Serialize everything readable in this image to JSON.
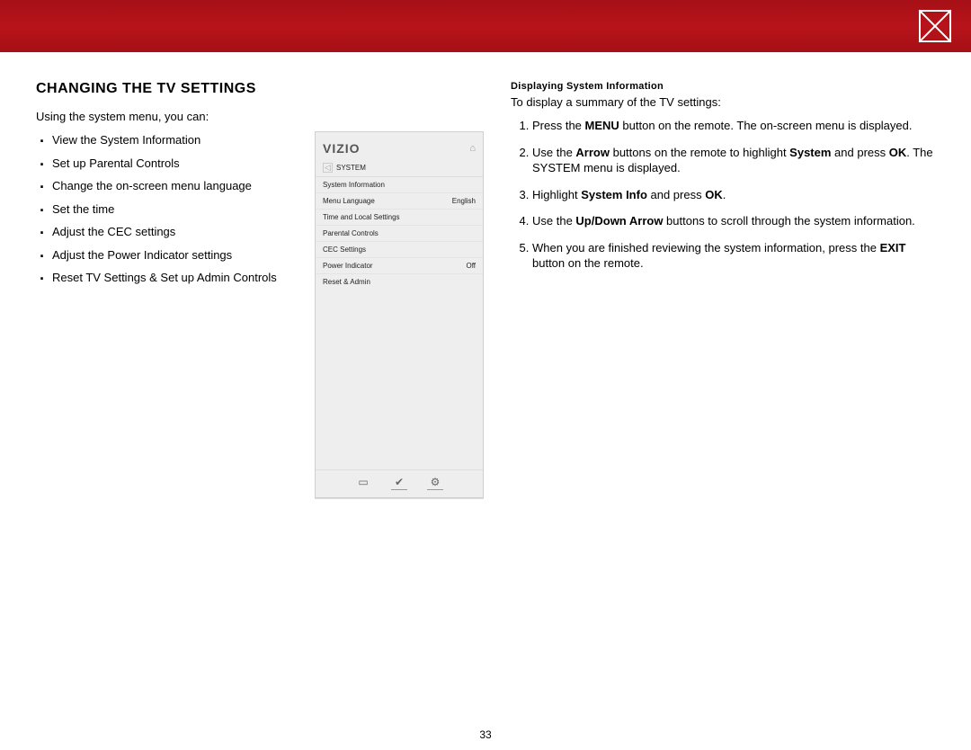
{
  "chapter_marker": "",
  "title": "CHANGING THE TV SETTINGS",
  "intro": "Using the system menu, you can:",
  "bullets": [
    "View the System Information",
    "Set up Parental Controls",
    "Change the on-screen menu language",
    "Set the time",
    "Adjust the CEC settings",
    "Adjust the Power Indicator settings",
    "Reset TV Settings & Set up Admin Controls"
  ],
  "osd": {
    "logo": "VIZIO",
    "breadcrumb": "SYSTEM",
    "items": [
      {
        "label": "System Information",
        "value": ""
      },
      {
        "label": "Menu Language",
        "value": "English"
      },
      {
        "label": "Time and Local Settings",
        "value": ""
      },
      {
        "label": "Parental Controls",
        "value": ""
      },
      {
        "label": "CEC Settings",
        "value": ""
      },
      {
        "label": "Power Indicator",
        "value": "Off"
      },
      {
        "label": "Reset & Admin",
        "value": ""
      }
    ],
    "footer_icons": {
      "wide": "▭",
      "v": "✔",
      "gear": "⚙"
    }
  },
  "right": {
    "heading_pre": "Displaying",
    "heading_post": "System Information",
    "intro": "To display a summary of the TV settings:",
    "steps": [
      {
        "parts": [
          "Press the ",
          {
            "bold": "MENU"
          },
          " button on the remote. The on-screen menu is displayed."
        ]
      },
      {
        "parts": [
          "Use the ",
          {
            "bold": "Arrow"
          },
          " buttons on the remote to highlight ",
          {
            "bold": "System"
          },
          " and press ",
          {
            "bold": "OK"
          },
          ". The SYSTEM menu is displayed."
        ]
      },
      {
        "parts": [
          "Highlight ",
          {
            "bold": "System Info"
          },
          " and press ",
          {
            "bold": "OK"
          },
          "."
        ]
      },
      {
        "parts": [
          "Use the ",
          {
            "bold": "Up/Down Arrow"
          },
          " buttons to scroll through the system information."
        ]
      },
      {
        "parts": [
          "When you are finished reviewing the system information, press the ",
          {
            "bold": "EXIT"
          },
          " button on the remote."
        ]
      }
    ]
  },
  "page_number": "33"
}
